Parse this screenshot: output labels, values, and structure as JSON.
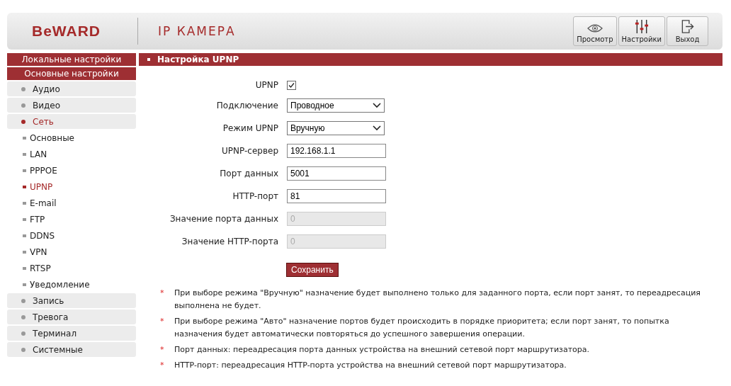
{
  "header": {
    "logo": "BeWARD",
    "product": "IP КАМЕРА",
    "buttons": [
      {
        "kind": "eye",
        "label": "Просмотр"
      },
      {
        "kind": "sliders",
        "label": "Настройки"
      },
      {
        "kind": "exit",
        "label": "Выход"
      }
    ]
  },
  "sidebar": {
    "sections": [
      "Локальные настройки",
      "Основные настройки"
    ],
    "items": [
      {
        "label": "Аудио",
        "selected": false
      },
      {
        "label": "Видео",
        "selected": false
      },
      {
        "label": "Сеть",
        "selected": true,
        "children": [
          {
            "label": "Основные",
            "selected": false
          },
          {
            "label": "LAN",
            "selected": false
          },
          {
            "label": "PPPOE",
            "selected": false
          },
          {
            "label": "UPNP",
            "selected": true
          },
          {
            "label": "E-mail",
            "selected": false
          },
          {
            "label": "FTP",
            "selected": false
          },
          {
            "label": "DDNS",
            "selected": false
          },
          {
            "label": "VPN",
            "selected": false
          },
          {
            "label": "RTSP",
            "selected": false
          },
          {
            "label": "Уведомление",
            "selected": false
          }
        ]
      },
      {
        "label": "Запись",
        "selected": false
      },
      {
        "label": "Тревога",
        "selected": false
      },
      {
        "label": "Терминал",
        "selected": false
      },
      {
        "label": "Системные",
        "selected": false
      }
    ]
  },
  "content": {
    "title": "Настройка UPNP",
    "fields": [
      {
        "kind": "checkbox",
        "label": "UPNP",
        "checked": true
      },
      {
        "kind": "select",
        "label": "Подключение",
        "value": "Проводное"
      },
      {
        "kind": "select",
        "label": "Режим UPNP",
        "value": "Вручную"
      },
      {
        "kind": "text",
        "label": "UPNP-сервер",
        "value": "192.168.1.1",
        "disabled": false
      },
      {
        "kind": "text",
        "label": "Порт данных",
        "value": "5001",
        "disabled": false
      },
      {
        "kind": "text",
        "label": "HTTP-порт",
        "value": "81",
        "disabled": false
      },
      {
        "kind": "text",
        "label": "Значение порта данных",
        "value": "0",
        "disabled": true
      },
      {
        "kind": "text",
        "label": "Значение HTTP-порта",
        "value": "0",
        "disabled": true
      }
    ],
    "save_button": "Сохранить",
    "notes": [
      {
        "mark": "*",
        "text": "При выборе режима \"Вручную\" назначение будет выполнено только для заданного порта, если порт занят, то переадресация выполнена не будет."
      },
      {
        "mark": "*",
        "text": "При выборе режима \"Авто\" назначение портов будет происходить в порядке приоритета; если порт занят, то попытка назначения будет автоматически повторяться до успешного завершения операции."
      },
      {
        "mark": "*",
        "text": "Порт данных: переадресация порта данных устройства на внешний сетевой порт маршрутизатора."
      },
      {
        "mark": "*",
        "text": "HTTP-порт: переадресация HTTP-порта устройства на внешний сетевой порт маршрутизатора."
      }
    ]
  }
}
